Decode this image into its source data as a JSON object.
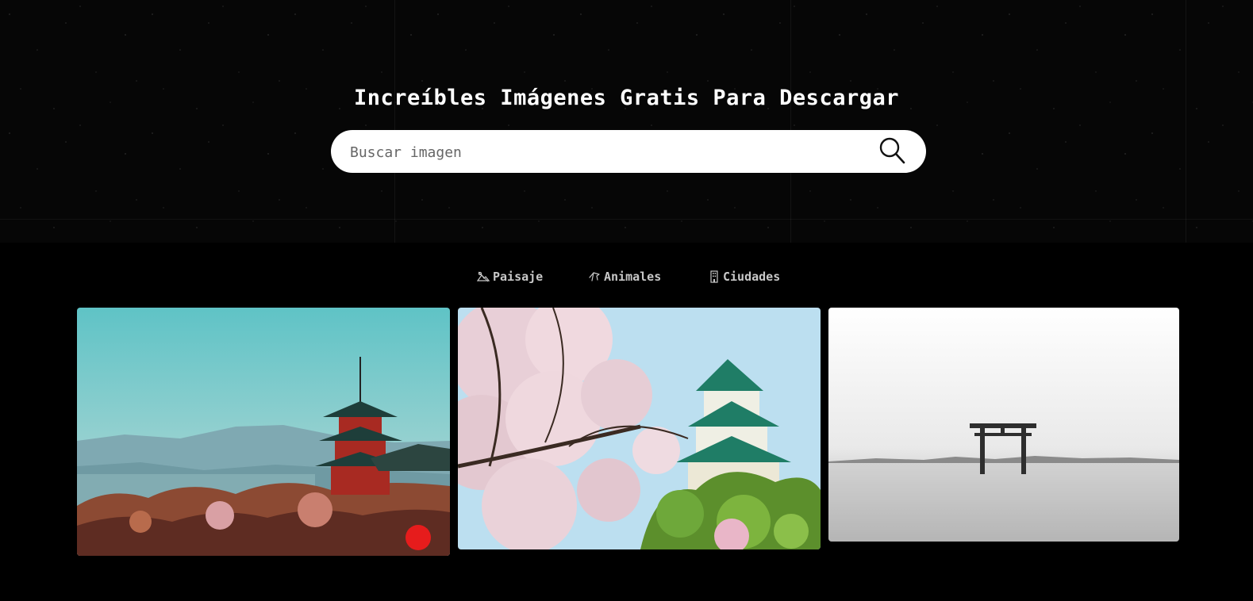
{
  "hero": {
    "title": "Increíbles Imágenes Gratis Para Descargar",
    "search_placeholder": "Buscar imagen",
    "search_value": "",
    "search_icon": "search-icon"
  },
  "categories": [
    {
      "label": "Paisaje",
      "icon": "landscape-icon"
    },
    {
      "label": "Animales",
      "icon": "animal-icon"
    },
    {
      "label": "Ciudades",
      "icon": "building-icon"
    }
  ],
  "gallery": {
    "images": [
      {
        "subject": "pagoda-landscape"
      },
      {
        "subject": "cherry-blossom-castle"
      },
      {
        "subject": "torii-gate-lake"
      }
    ]
  },
  "colors": {
    "background": "#000000",
    "search_bar": "#ffffff",
    "category_text": "#c8c8c8",
    "title_text": "#ffffff"
  }
}
